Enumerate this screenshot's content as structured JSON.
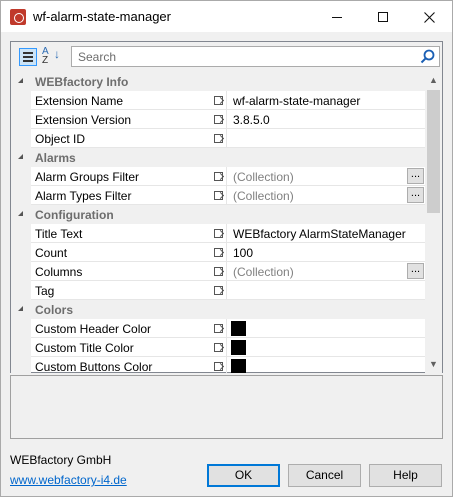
{
  "window": {
    "title": "wf-alarm-state-manager"
  },
  "toolbar": {
    "search_placeholder": "Search"
  },
  "rows": [
    {
      "kind": "category",
      "label": "WEBfactory Info"
    },
    {
      "kind": "property",
      "name": "Extension Name",
      "value": "wf-alarm-state-manager"
    },
    {
      "kind": "property",
      "name": "Extension Version",
      "value": "3.8.5.0"
    },
    {
      "kind": "property",
      "name": "Object ID",
      "value": ""
    },
    {
      "kind": "category",
      "label": "Alarms"
    },
    {
      "kind": "property",
      "name": "Alarm Groups Filter",
      "value": "(Collection)",
      "muted": true,
      "ellipsis": true
    },
    {
      "kind": "property",
      "name": "Alarm Types Filter",
      "value": "(Collection)",
      "muted": true,
      "ellipsis": true
    },
    {
      "kind": "category",
      "label": "Configuration"
    },
    {
      "kind": "property",
      "name": "Title Text",
      "value": "WEBfactory AlarmStateManager"
    },
    {
      "kind": "property",
      "name": "Count",
      "value": "100"
    },
    {
      "kind": "property",
      "name": "Columns",
      "value": "(Collection)",
      "muted": true,
      "ellipsis": true
    },
    {
      "kind": "property",
      "name": "Tag",
      "value": ""
    },
    {
      "kind": "category",
      "label": "Colors"
    },
    {
      "kind": "property",
      "name": "Custom Header Color",
      "value": "",
      "swatch": "#000000"
    },
    {
      "kind": "property",
      "name": "Custom Title Color",
      "value": "",
      "swatch": "#000000"
    },
    {
      "kind": "property",
      "name": "Custom Buttons Color",
      "value": "",
      "swatch": "#000000"
    }
  ],
  "footer": {
    "company": "WEBfactory GmbH",
    "link": "www.webfactory-i4.de",
    "ok_label": "OK",
    "cancel_label": "Cancel",
    "help_label": "Help"
  },
  "icons": {
    "app": "app-icon",
    "categorized": "categorized-view-icon",
    "alphabetical": "alphabetical-sort-icon",
    "search": "search-icon"
  },
  "colors": {
    "accent": "#0078d7",
    "link": "#0066cc"
  }
}
